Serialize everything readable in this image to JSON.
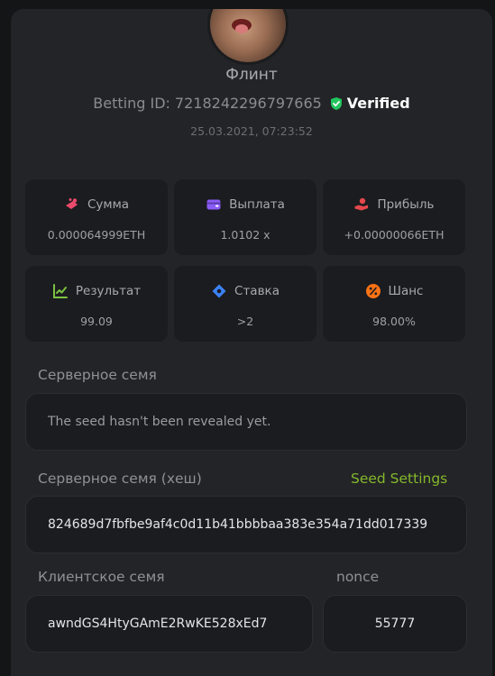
{
  "profile": {
    "username": "Флинт",
    "betting_id_label": "Betting ID:",
    "betting_id": "7218242296797665",
    "verified_label": "Verified",
    "timestamp": "25.03.2021, 07:23:52"
  },
  "stats": [
    {
      "label": "Сумма",
      "value": "0.000064999ETH",
      "icon": "coins-icon",
      "color": "#e94b6b"
    },
    {
      "label": "Выплата",
      "value": "1.0102 x",
      "icon": "wallet-icon",
      "color": "#8b5cf6"
    },
    {
      "label": "Прибыль",
      "value": "+0.00000066ETH",
      "icon": "hand-profit-icon",
      "color": "#e5484d"
    },
    {
      "label": "Результат",
      "value": "99.09",
      "icon": "chart-check-icon",
      "color": "#7cc242"
    },
    {
      "label": "Ставка",
      "value": ">2",
      "icon": "tag-icon",
      "color": "#3b82f6"
    },
    {
      "label": "Шанс",
      "value": "98.00%",
      "icon": "percent-icon",
      "color": "#f97316"
    }
  ],
  "server_seed": {
    "label": "Серверное семя",
    "value": "The seed hasn't been revealed yet."
  },
  "server_seed_hash": {
    "label": "Серверное семя (хеш)",
    "settings_link": "Seed Settings",
    "value": "824689d7fbfbe9af4c0d11b41bbbbaa383e354a71dd017339"
  },
  "client_seed": {
    "label": "Клиентское семя",
    "value": "awndGS4HtyGAmE2RwKE528xEd7"
  },
  "nonce": {
    "label": "nonce",
    "value": "55777"
  },
  "colors": {
    "accent_green": "#84b72b",
    "verified_shield": "#22c55e"
  }
}
